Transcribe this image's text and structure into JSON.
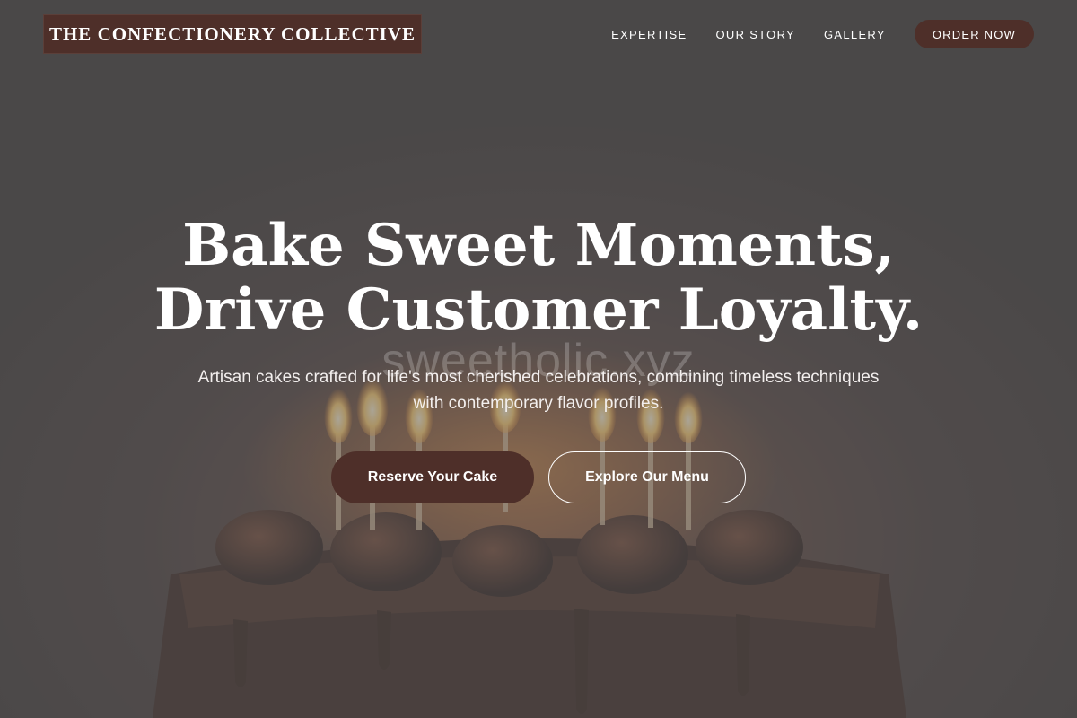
{
  "header": {
    "logo_text": "THE CONFECTIONERY COLLECTIVE",
    "nav": [
      {
        "label": "EXPERTISE"
      },
      {
        "label": "OUR STORY"
      },
      {
        "label": "GALLERY"
      }
    ],
    "cta_label": "ORDER NOW"
  },
  "hero": {
    "headline_line1": "Bake Sweet Moments,",
    "headline_line2": "Drive Customer Loyalty.",
    "subtitle_line1": "Artisan cakes crafted for life's most cherished celebrations, combining timeless techniques",
    "subtitle_line2": "with contemporary flavor profiles.",
    "primary_button": "Reserve Your Cake",
    "secondary_button": "Explore Our Menu",
    "watermark": "sweetholic.xyz",
    "background_image": "chocolate-birthday-cake-with-candles"
  },
  "colors": {
    "brand": "#4e2f29",
    "text_light": "#ffffff",
    "overlay": "#646060"
  }
}
